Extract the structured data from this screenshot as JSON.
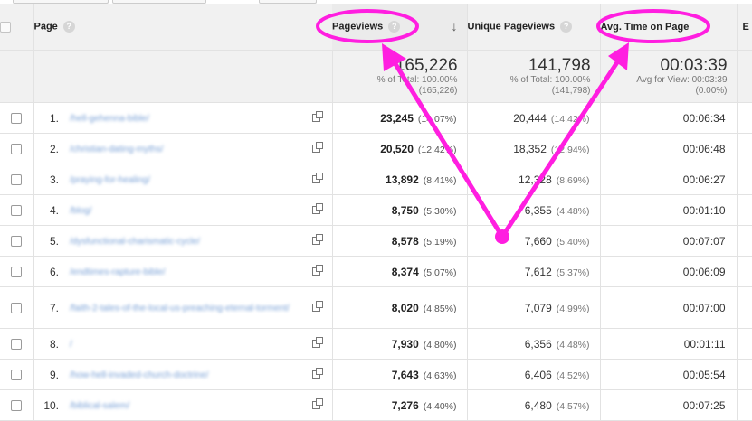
{
  "header": {
    "checkbox": "",
    "page_col": "Page",
    "pageviews_col": "Pageviews",
    "unique_col": "Unique Pageviews",
    "avg_col": "Avg. Time on Page",
    "next_col": "E",
    "help_glyph": "?",
    "sort_glyph": "↓"
  },
  "totals": {
    "pageviews": "165,226",
    "pageviews_pct": "% of Total: 100.00%",
    "pageviews_abs": "(165,226)",
    "unique": "141,798",
    "unique_pct": "% of Total: 100.00%",
    "unique_abs": "(141,798)",
    "avg": "00:03:39",
    "avg_view": "Avg for View: 00:03:39",
    "avg_pct": "(0.00%)"
  },
  "rows": [
    {
      "num": "1.",
      "page": "/hell-gehenna-bible/",
      "pageviews": "23,245",
      "pv_pct": "(14.07%)",
      "unique": "20,444",
      "u_pct": "(14.42%)",
      "avg": "00:06:34"
    },
    {
      "num": "2.",
      "page": "/christian-dating-myths/",
      "pageviews": "20,520",
      "pv_pct": "(12.42%)",
      "unique": "18,352",
      "u_pct": "(12.94%)",
      "avg": "00:06:48"
    },
    {
      "num": "3.",
      "page": "/praying-for-healing/",
      "pageviews": "13,892",
      "pv_pct": "(8.41%)",
      "unique": "12,328",
      "u_pct": "(8.69%)",
      "avg": "00:06:27"
    },
    {
      "num": "4.",
      "page": "/blog/",
      "pageviews": "8,750",
      "pv_pct": "(5.30%)",
      "unique": "6,355",
      "u_pct": "(4.48%)",
      "avg": "00:01:10"
    },
    {
      "num": "5.",
      "page": "/dysfunctional-charismatic-cycle/",
      "pageviews": "8,578",
      "pv_pct": "(5.19%)",
      "unique": "7,660",
      "u_pct": "(5.40%)",
      "avg": "00:07:07"
    },
    {
      "num": "6.",
      "page": "/endtimes-rapture-bible/",
      "pageviews": "8,374",
      "pv_pct": "(5.07%)",
      "unique": "7,612",
      "u_pct": "(5.37%)",
      "avg": "00:06:09"
    },
    {
      "num": "7.",
      "page": "/faith-2-tales-of-the-local-us-preaching-eternal-torment/",
      "pageviews": "8,020",
      "pv_pct": "(4.85%)",
      "unique": "7,079",
      "u_pct": "(4.99%)",
      "avg": "00:07:00"
    },
    {
      "num": "8.",
      "page": "/",
      "pageviews": "7,930",
      "pv_pct": "(4.80%)",
      "unique": "6,356",
      "u_pct": "(4.48%)",
      "avg": "00:01:11"
    },
    {
      "num": "9.",
      "page": "/how-hell-invaded-church-doctrine/",
      "pageviews": "7,643",
      "pv_pct": "(4.63%)",
      "unique": "6,406",
      "u_pct": "(4.52%)",
      "avg": "00:05:54"
    },
    {
      "num": "10.",
      "page": "/biblical-salem/",
      "pageviews": "7,276",
      "pv_pct": "(4.40%)",
      "unique": "6,480",
      "u_pct": "(4.57%)",
      "avg": "00:07:25"
    }
  ],
  "colors": {
    "annotation": "#ff1ee0",
    "header_bg": "#f1f1f1",
    "link": "#7aa1d6"
  }
}
